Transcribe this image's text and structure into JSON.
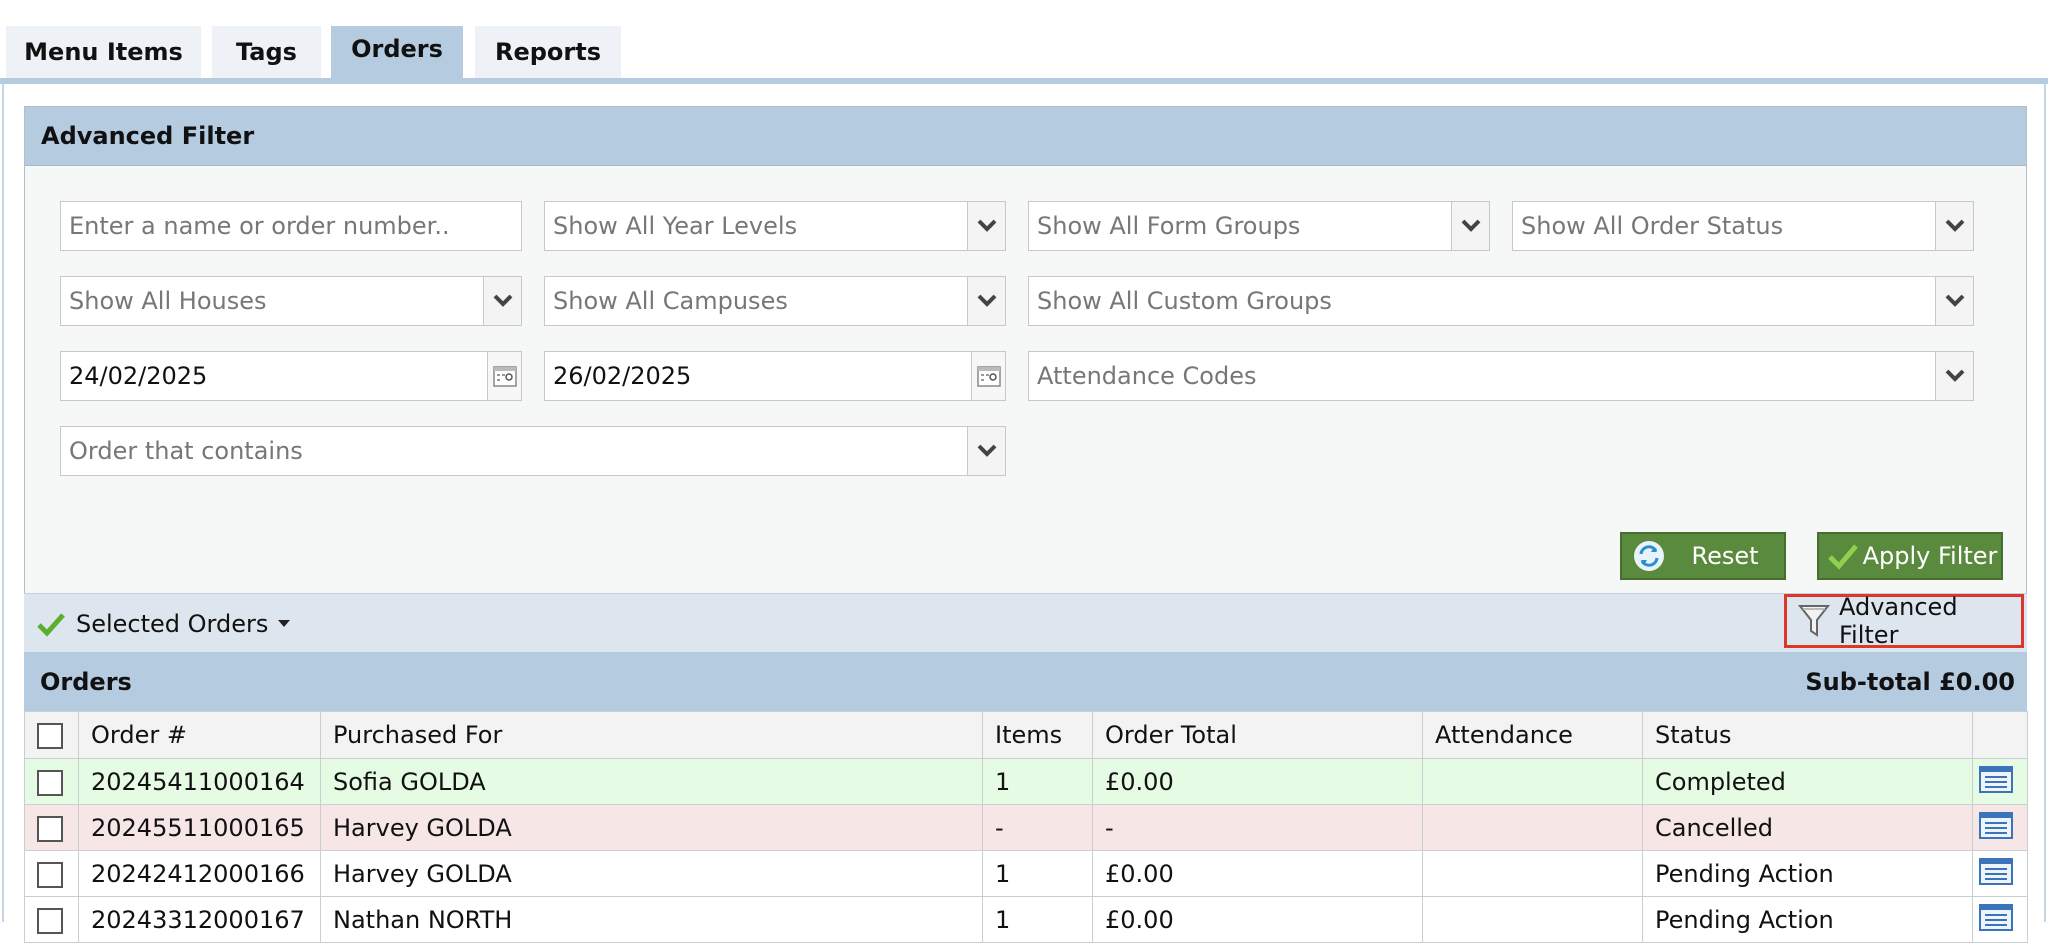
{
  "tabs": [
    {
      "label": "Menu Items"
    },
    {
      "label": "Tags"
    },
    {
      "label": "Orders",
      "active": true
    },
    {
      "label": "Reports"
    }
  ],
  "filter": {
    "title": "Advanced Filter",
    "search_placeholder": "Enter a name or order number..",
    "year_levels": "Show All Year Levels",
    "form_groups": "Show All Form Groups",
    "order_status": "Show All Order Status",
    "houses": "Show All Houses",
    "campuses": "Show All Campuses",
    "custom_groups": "Show All Custom Groups",
    "date_from": "24/02/2025",
    "date_to": "26/02/2025",
    "attendance_codes": "Attendance Codes",
    "order_contains": "Order that contains",
    "reset_label": "Reset",
    "apply_label": "Apply Filter"
  },
  "toolbar": {
    "selected_orders": "Selected Orders",
    "advanced_filter": "Advanced Filter"
  },
  "orders": {
    "title": "Orders",
    "subtotal": "Sub-total £0.00",
    "columns": [
      "Order #",
      "Purchased For",
      "Items",
      "Order Total",
      "Attendance",
      "Status"
    ],
    "rows": [
      {
        "order": "20245411000164",
        "for": "Sofia GOLDA",
        "items": "1",
        "total": "£0.00",
        "attendance": "",
        "status": "Completed",
        "state": "completed"
      },
      {
        "order": "20245511000165",
        "for": "Harvey GOLDA",
        "items": "-",
        "total": "-",
        "attendance": "",
        "status": "Cancelled",
        "state": "cancelled"
      },
      {
        "order": "20242412000166",
        "for": "Harvey GOLDA",
        "items": "1",
        "total": "£0.00",
        "attendance": "",
        "status": "Pending Action",
        "state": "pending"
      },
      {
        "order": "20243312000167",
        "for": "Nathan NORTH",
        "items": "1",
        "total": "£0.00",
        "attendance": "",
        "status": "Pending Action",
        "state": "pending"
      }
    ]
  },
  "colors": {
    "header_blue": "#b4cbe0",
    "button_green": "#5a8a3d",
    "highlight_red": "#d9382b",
    "completed_row": "#e6fbe3",
    "cancelled_row": "#f7e6e6"
  }
}
